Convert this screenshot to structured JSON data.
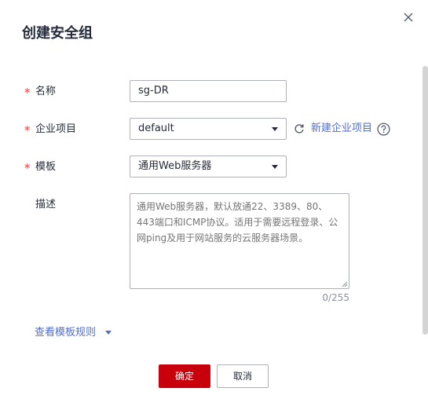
{
  "dialog": {
    "title": "创建安全组"
  },
  "form": {
    "name": {
      "label": "名称",
      "required": true,
      "value": "sg-DR"
    },
    "enterprise_project": {
      "label": "企业项目",
      "required": true,
      "selected": "default",
      "create_link": "新建企业项目"
    },
    "template": {
      "label": "模板",
      "required": true,
      "selected": "通用Web服务器"
    },
    "description": {
      "label": "描述",
      "placeholder": "通用Web服务器，默认放通22、3389、80、443端口和ICMP协议。适用于需要远程登录、公网ping及用于网站服务的云服务器场景。",
      "counter": "0/255"
    },
    "view_rules_link": "查看模板规则"
  },
  "footer": {
    "confirm_label": "确定",
    "cancel_label": "取消"
  },
  "colors": {
    "required_star": "#e54545",
    "link": "#526ecc",
    "primary_button": "#c7000b"
  },
  "icons": {
    "close": "close-icon",
    "refresh": "refresh-icon",
    "help": "help-circle-icon",
    "dropdown": "caret-down-icon"
  }
}
